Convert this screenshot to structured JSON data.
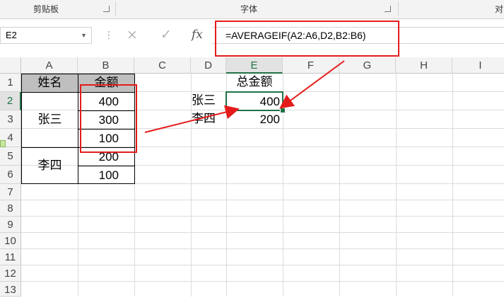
{
  "ribbon": {
    "groups": [
      "剪贴板",
      "字体",
      "对"
    ]
  },
  "formula_bar": {
    "name_box": "E2",
    "formula": "=AVERAGEIF(A2:A6,D2,B2:B6)",
    "cancel_icon": "×",
    "enter_icon": "✓",
    "fx_label": "fx"
  },
  "columns": [
    "A",
    "B",
    "C",
    "D",
    "E",
    "F",
    "G",
    "H",
    "I"
  ],
  "rows": [
    "1",
    "2",
    "3",
    "4",
    "5",
    "6",
    "7",
    "8",
    "9",
    "10",
    "11",
    "12",
    "13"
  ],
  "table": {
    "headers": [
      "姓名",
      "金额"
    ],
    "names": [
      "张三",
      "李四"
    ],
    "amounts": [
      "400",
      "300",
      "100",
      "200",
      "100"
    ]
  },
  "summary": {
    "header": "总金额",
    "names": [
      "张三",
      "李四"
    ],
    "values": [
      "400",
      "200"
    ]
  },
  "colors": {
    "accent": "#217346",
    "annotation": "#e41b1b",
    "header_fill": "#bfbfbf"
  }
}
